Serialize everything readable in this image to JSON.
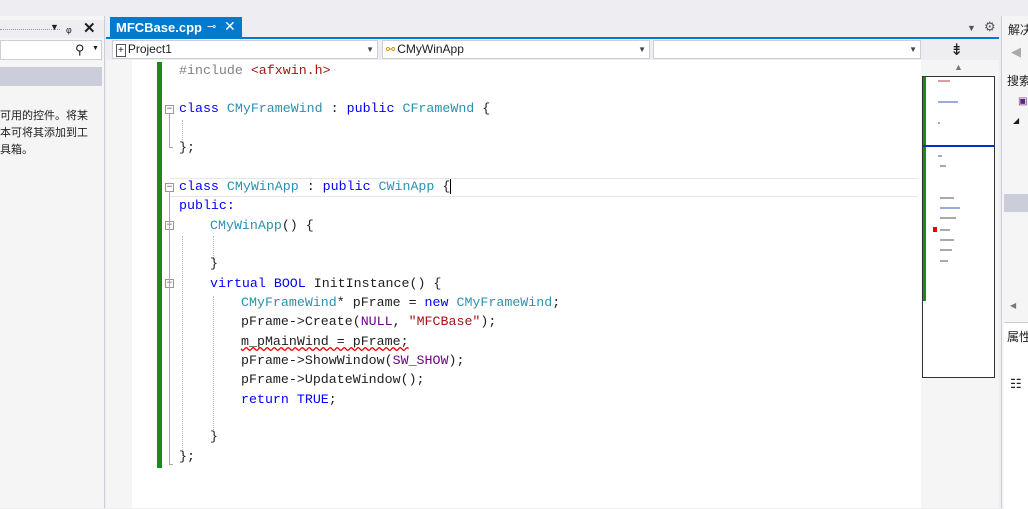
{
  "left_panel": {
    "hint_lines": [
      "可用的控件。将某",
      "本可将其添加到工",
      "具箱。"
    ]
  },
  "editor_tab": {
    "title": "MFCBase.cpp"
  },
  "navigation": {
    "project": "Project1",
    "class_scope": "CMyWinApp",
    "member": ""
  },
  "code": {
    "line1_directive": "#include ",
    "line1_header": "<afxwin.h>",
    "class1_kw": "class ",
    "class1_name": "CMyFrameWind",
    "class1_sep": " : ",
    "class1_public": "public ",
    "class1_base": "CFrameWnd",
    "class1_brace": " {",
    "class1_close": "};",
    "class2_kw": "class ",
    "class2_name": "CMyWinApp",
    "class2_sep": " : ",
    "class2_public": "public ",
    "class2_base": "CWinApp",
    "class2_brace": " {",
    "access_public": "public:",
    "ctor_name": "CMyWinApp",
    "ctor_rest": "() {",
    "ctor_close": "}",
    "virtual_kw": "virtual ",
    "bool_kw": "BOOL",
    "init_rest": " InitInstance() {",
    "s1_type": "CMyFrameWind",
    "s1_mid": "* pFrame = ",
    "s1_new": "new ",
    "s1_ctor": "CMyFrameWind",
    "s1_end": ";",
    "s2_pre": "pFrame->Create(",
    "s2_null": "NULL",
    "s2_comma": ", ",
    "s2_str": "\"MFCBase\"",
    "s2_end": ");",
    "s3": "m_pMainWind = pFrame;",
    "s4_pre": "pFrame->ShowWindow(",
    "s4_macro": "SW_SHOW",
    "s4_end": ");",
    "s5": "pFrame->UpdateWindow();",
    "s6_return": "return ",
    "s6_true": "TRUE",
    "s6_end": ";",
    "init_close": "}",
    "class2_close": "};"
  },
  "right_panel": {
    "title": "解决",
    "search_label": "搜索",
    "props_label": "属性"
  },
  "colors": {
    "accent": "#007acc",
    "keyword": "#0000ff",
    "type": "#2b91af",
    "string": "#a31515",
    "macro": "#6f008a",
    "changed_bar": "#1a8a1a"
  },
  "icons": [
    "search-icon",
    "dropdown-icon",
    "pin-icon",
    "close-icon",
    "split-editor-icon",
    "settings-icon",
    "class-icon",
    "project-icon",
    "back-icon",
    "properties-icon"
  ]
}
